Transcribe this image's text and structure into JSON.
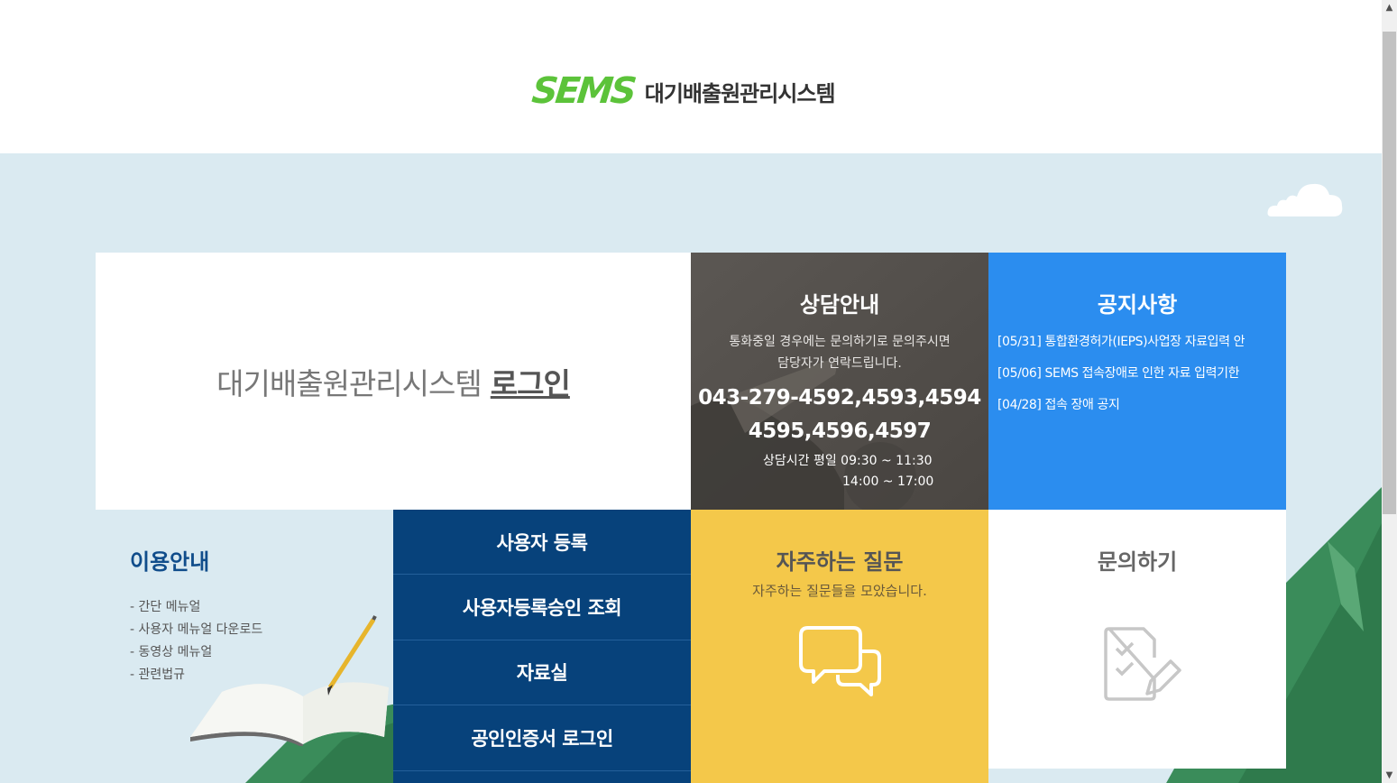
{
  "header": {
    "logo_mark": "SEMS",
    "logo_text": "대기배출원관리시스템"
  },
  "login": {
    "text": "대기배출원관리시스템",
    "link": "로그인"
  },
  "consult": {
    "title": "상담안내",
    "desc_line1": "통화중일 경우에는 문의하기로 문의주시면",
    "desc_line2": "담당자가 연락드립니다.",
    "phone_line1": "043-279-4592,4593,4594",
    "phone_line2": "4595,4596,4597",
    "hours_line1": "상담시간 평일 09:30 ~ 11:30",
    "hours_line2": "14:00 ~ 17:00"
  },
  "notice": {
    "title": "공지사항",
    "items": [
      "[05/31] 통합환경허가(IEPS)사업장 자료입력 안",
      "[05/06] SEMS 접속장애로 인한 자료 입력기한",
      "[04/28] 접속 장애 공지"
    ]
  },
  "guide": {
    "title": "이용안내",
    "items": [
      "- 간단 메뉴얼",
      "- 사용자 메뉴얼 다운로드",
      "- 동영상 메뉴얼",
      "- 관련법규"
    ]
  },
  "menu": {
    "items": [
      "사용자 등록",
      "사용자등록승인 조회",
      "자료실",
      "공인인증서 로그인"
    ]
  },
  "faq": {
    "title": "자주하는 질문",
    "subtitle": "자주하는 질문들을 모았습니다."
  },
  "qna": {
    "title": "문의하기"
  },
  "icons": {
    "faq": "speech-bubbles-icon",
    "qna": "checklist-edit-icon",
    "scroll_up": "chevron-up-icon",
    "scroll_down": "chevron-down-icon"
  },
  "colors": {
    "brand_green": "#5cc33a",
    "background": "#daeaf1",
    "consult_bg": "#56524e",
    "notice_bg": "#2b8def",
    "menu_bg": "#07427b",
    "faq_bg": "#f4c84a",
    "guide_title": "#104d8b"
  }
}
